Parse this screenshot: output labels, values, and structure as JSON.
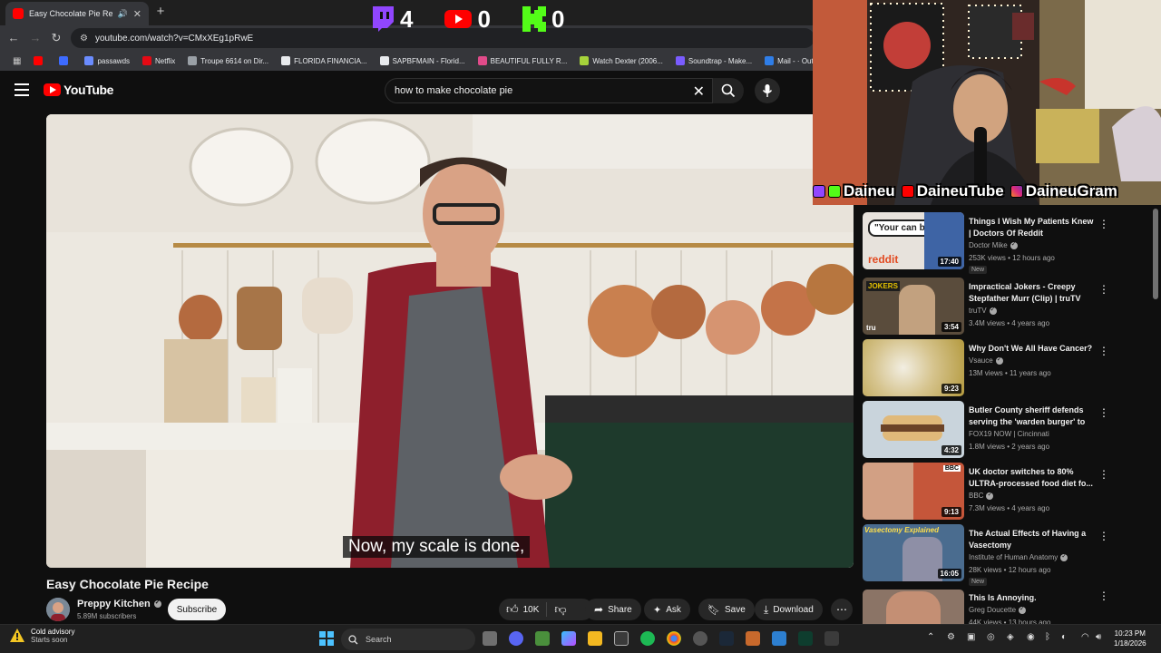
{
  "browser": {
    "tab_title": "Easy Chocolate Pie Recipe",
    "new_tab_glyph": "+",
    "url": "youtube.com/watch?v=CMxXEg1pRwE",
    "bookmarks": [
      {
        "label": "",
        "color": "#ff0000"
      },
      {
        "label": "",
        "color": "#3d6bff"
      },
      {
        "label": "passawds",
        "color": "#6b8cff"
      },
      {
        "label": "Netflix",
        "color": "#e50914"
      },
      {
        "label": "Troupe 6614 on Dir...",
        "color": "#9aa0a6"
      },
      {
        "label": "FLORIDA FINANCIA...",
        "color": "#e8eaed"
      },
      {
        "label": "SAPBFMAIN - Florid...",
        "color": "#e8eaed"
      },
      {
        "label": "BEAUTIFUL FULLY R...",
        "color": "#e14b8a"
      },
      {
        "label": "Watch Dexter (2006...",
        "color": "#a6d33b"
      },
      {
        "label": "Soundtrap - Make...",
        "color": "#7a5cff"
      },
      {
        "label": "Mail - · Outlook",
        "color": "#2f7ee8"
      }
    ]
  },
  "youtube": {
    "logo_text": "YouTube",
    "search_query": "how to make chocolate pie"
  },
  "video": {
    "caption": "Now, my scale is done,",
    "title": "Easy Chocolate Pie Recipe",
    "channel": "Preppy Kitchen",
    "subscribers": "5.89M subscribers",
    "subscribe_label": "Subscribe",
    "likes": "10K",
    "share_label": "Share",
    "ask_label": "Ask",
    "save_label": "Save",
    "download_label": "Download"
  },
  "recommendations": [
    {
      "title": "Things I Wish My Patients Knew | Doctors Of Reddit",
      "channel": "Doctor Mike",
      "verified": true,
      "meta": "253K views • 12 hours ago",
      "badge": "New",
      "duration": "17:40",
      "thumb_text": "\"Your can break\"",
      "thumb_sub": "reddit"
    },
    {
      "title": "Impractical Jokers - Creepy Stepfather Murr (Clip) | truTV",
      "channel": "truTV",
      "verified": true,
      "meta": "3.4M views • 4 years ago",
      "badge": "",
      "duration": "3:54",
      "thumb_text": "JOKERS",
      "thumb_sub": "tru"
    },
    {
      "title": "Why Don't We All Have Cancer?",
      "channel": "Vsauce",
      "verified": true,
      "meta": "13M views • 11 years ago",
      "badge": "",
      "duration": "9:23",
      "thumb_text": "",
      "thumb_sub": ""
    },
    {
      "title": "Butler County sheriff defends serving the 'warden burger' to ...",
      "channel": "FOX19 NOW | Cincinnati",
      "verified": false,
      "meta": "1.8M views • 2 years ago",
      "badge": "",
      "duration": "4:32",
      "thumb_text": "",
      "thumb_sub": ""
    },
    {
      "title": "UK doctor switches to 80% ULTRA-processed food diet fo...",
      "channel": "BBC",
      "verified": true,
      "meta": "7.3M views • 4 years ago",
      "badge": "",
      "duration": "9:13",
      "thumb_text": "BBC",
      "thumb_sub": ""
    },
    {
      "title": "The Actual Effects of Having a Vasectomy",
      "channel": "Institute of Human Anatomy",
      "verified": true,
      "meta": "28K views • 12 hours ago",
      "badge": "New",
      "duration": "16:05",
      "thumb_text": "Vasectomy Explained",
      "thumb_sub": ""
    },
    {
      "title": "This Is Annoying.",
      "channel": "Greg Doucette",
      "verified": true,
      "meta": "44K views • 13 hours ago",
      "badge": "",
      "duration": "",
      "thumb_text": "",
      "thumb_sub": ""
    }
  ],
  "stream_overlay": {
    "counters": [
      {
        "platform": "Twitch",
        "value": "4",
        "color": "#9146ff"
      },
      {
        "platform": "YouTube",
        "value": "0",
        "color": "#ff0000"
      },
      {
        "platform": "Kick",
        "value": "0",
        "color": "#53fc18"
      }
    ],
    "handles": [
      {
        "name": "Daineu",
        "icons": [
          "twitch-icon",
          "kick-icon"
        ]
      },
      {
        "name": "DaineuTube",
        "icons": [
          "youtube-icon"
        ]
      },
      {
        "name": "DaineuGram",
        "icons": [
          "instagram-icon"
        ]
      }
    ]
  },
  "taskbar": {
    "weather_title": "Cold advisory",
    "weather_sub": "Starts soon",
    "search_label": "Search",
    "time": "10:23 PM",
    "date": "1/18/2026"
  },
  "colors": {
    "youtube_red": "#ff0000",
    "background": "#0f0f0f",
    "twitch_purple": "#9146ff",
    "kick_green": "#53fc18"
  }
}
